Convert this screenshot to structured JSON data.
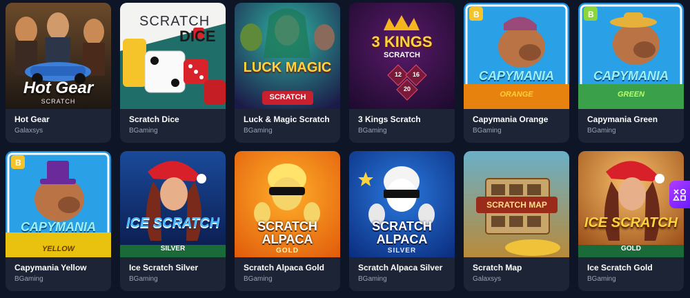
{
  "games": [
    {
      "title": "Hot Gear",
      "provider": "Galaxsys",
      "art_text": "Hot Gear",
      "art_sub": "SCRATCH",
      "theme": "hotgear-art-icon"
    },
    {
      "title": "Scratch Dice",
      "provider": "BGaming",
      "art_text": "SCRATCH",
      "art_sub": "DICE",
      "theme": "dice-art-icon"
    },
    {
      "title": "Luck & Magic Scratch",
      "provider": "BGaming",
      "art_text": "LUCK MAGIC",
      "art_sub": "SCRATCH",
      "theme": "luck-magic-art-icon"
    },
    {
      "title": "3 Kings Scratch",
      "provider": "BGaming",
      "art_text": "3 KINGS",
      "art_sub": "SCRATCH",
      "theme": "kings-art-icon"
    },
    {
      "title": "Capymania Orange",
      "provider": "BGaming",
      "art_text": "CAPYMANIA",
      "art_sub": "ORANGE",
      "theme": "capybara-art-icon"
    },
    {
      "title": "Capymania Green",
      "provider": "BGaming",
      "art_text": "CAPYMANIA",
      "art_sub": "GREEN",
      "theme": "capybara-art-icon"
    },
    {
      "title": "Capymania Yellow",
      "provider": "BGaming",
      "art_text": "CAPYMANIA",
      "art_sub": "YELLOW",
      "theme": "capybara-art-icon"
    },
    {
      "title": "Ice Scratch Silver",
      "provider": "BGaming",
      "art_text": "ICE SCRATCH",
      "art_sub": "SILVER",
      "theme": "santa-girl-art-icon"
    },
    {
      "title": "Scratch Alpaca Gold",
      "provider": "BGaming",
      "art_text": "SCRATCH ALPACA",
      "art_sub": "GOLD",
      "theme": "alpaca-art-icon"
    },
    {
      "title": "Scratch Alpaca Silver",
      "provider": "BGaming",
      "art_text": "SCRATCH ALPACA",
      "art_sub": "SILVER",
      "theme": "alpaca-art-icon"
    },
    {
      "title": "Scratch Map",
      "provider": "Galaxsys",
      "art_text": "SCRATCH MAP",
      "art_sub": "",
      "theme": "map-art-icon"
    },
    {
      "title": "Ice Scratch Gold",
      "provider": "BGaming",
      "art_text": "ICE SCRATCH",
      "art_sub": "GOLD",
      "theme": "santa-girl-art-icon"
    }
  ],
  "dice_numbers": [
    "12",
    "16",
    "20"
  ],
  "badge_letter": "B",
  "colors": {
    "page_bg": "#0e1526",
    "card_bg": "#1c2436",
    "title": "#ffffff",
    "provider": "#9aa3b5",
    "accent_purple": "#8a2be2"
  }
}
